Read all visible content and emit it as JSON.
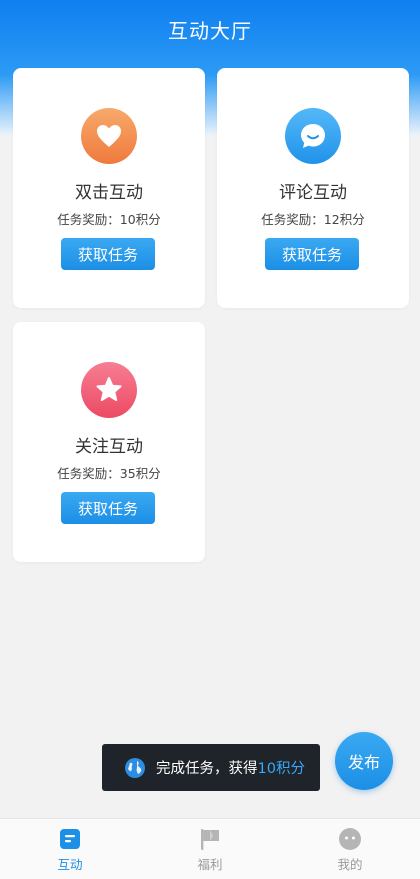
{
  "header": {
    "title": "互动大厅"
  },
  "cards": [
    {
      "title": "双击互动",
      "reward": "任务奖励：10积分",
      "button": "获取任务",
      "icon": "heart-icon",
      "color_from": "#f7a96b",
      "color_to": "#ef7a3c"
    },
    {
      "title": "评论互动",
      "reward": "任务奖励：12积分",
      "button": "获取任务",
      "icon": "chat-bubble-icon",
      "color_from": "#54b8f8",
      "color_to": "#1f93ea"
    },
    {
      "title": "关注互动",
      "reward": "任务奖励：35积分",
      "button": "获取任务",
      "icon": "star-icon",
      "color_from": "#f77e93",
      "color_to": "#ec4a63"
    }
  ],
  "fab": {
    "label": "发布"
  },
  "toast": {
    "prefix": "完成任务，获得",
    "highlight": "10积分"
  },
  "tabbar": {
    "items": [
      {
        "label": "互动",
        "icon": "interaction-icon",
        "active": true
      },
      {
        "label": "福利",
        "icon": "flag-icon",
        "active": false
      },
      {
        "label": "我的",
        "icon": "profile-face-icon",
        "active": false
      }
    ]
  },
  "colors": {
    "accent": "#1c8fe6",
    "header_top": "#0f7ff0",
    "inactive_tab": "#9a9a9a"
  }
}
